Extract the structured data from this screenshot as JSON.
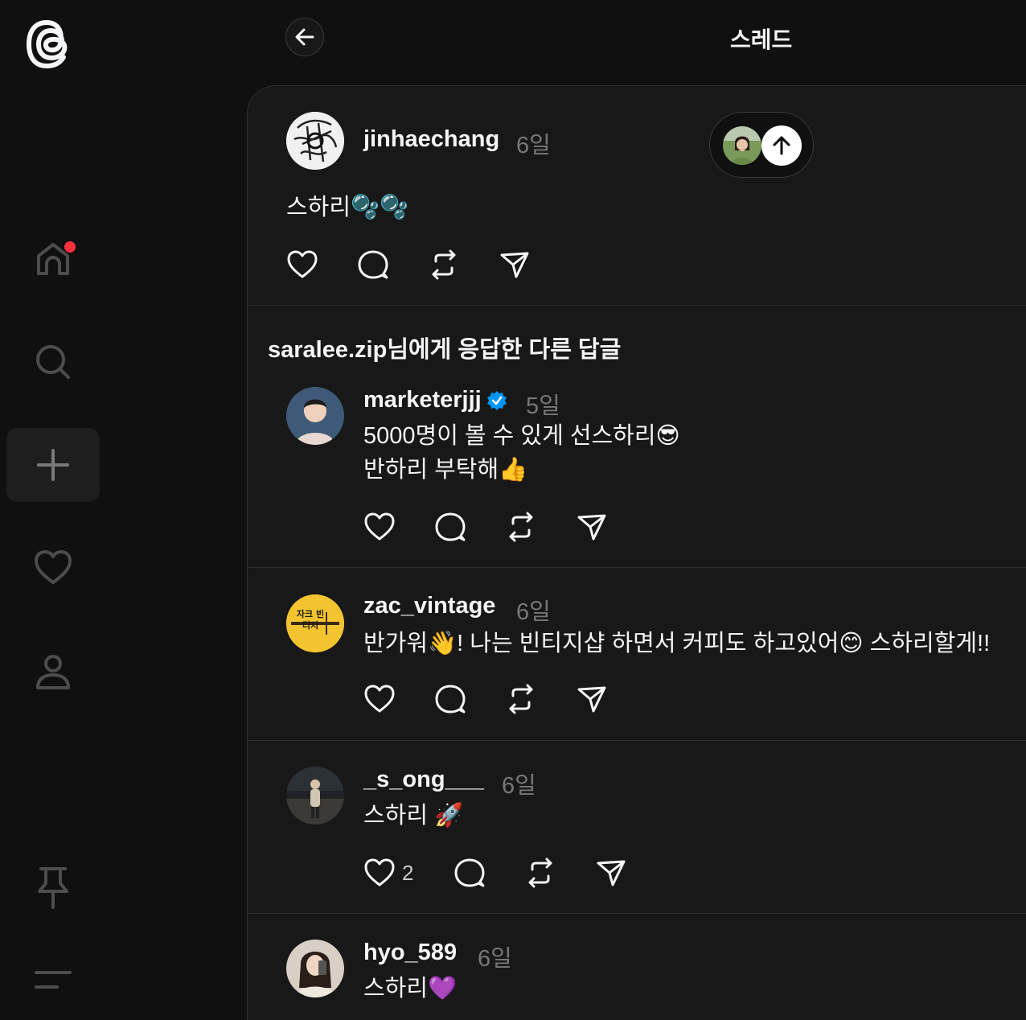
{
  "app": {
    "page_title": "스레드"
  },
  "sidebar": {
    "items": [
      {
        "name": "home",
        "icon": "home-icon",
        "has_notification": true
      },
      {
        "name": "search",
        "icon": "search-icon"
      },
      {
        "name": "create",
        "icon": "plus-icon",
        "active": true
      },
      {
        "name": "activity",
        "icon": "heart-icon"
      },
      {
        "name": "profile",
        "icon": "person-icon"
      },
      {
        "name": "pin",
        "icon": "pin-icon"
      },
      {
        "name": "menu",
        "icon": "menu-icon"
      }
    ]
  },
  "colors": {
    "accent": "#0095f6",
    "notification": "#ff3040",
    "background": "#101010",
    "panel": "#181818"
  },
  "main_post": {
    "username": "jinhaechang",
    "time": "6일",
    "text": "스하리🫧🫧"
  },
  "section_title": "saralee.zip님에게 응답한 다른 답글",
  "replies": [
    {
      "username": "marketerjjj",
      "verified": true,
      "time": "5일",
      "lines": [
        "5000명이 볼 수 있게 선스하리😎",
        "반하리 부탁해👍"
      ],
      "likes": ""
    },
    {
      "username": "zac_vintage",
      "verified": false,
      "time": "6일",
      "lines": [
        "반가워👋! 나는 빈티지샵 하면서 커피도 하고있어😊 스하리할게!!"
      ],
      "likes": "",
      "avatar_text": "자크 빈티지"
    },
    {
      "username": "_s_ong___",
      "verified": false,
      "time": "6일",
      "lines": [
        "스하리 🚀"
      ],
      "likes": "2"
    },
    {
      "username": "hyo_589",
      "verified": false,
      "time": "6일",
      "lines": [
        "스하리💜"
      ],
      "likes": ""
    }
  ]
}
